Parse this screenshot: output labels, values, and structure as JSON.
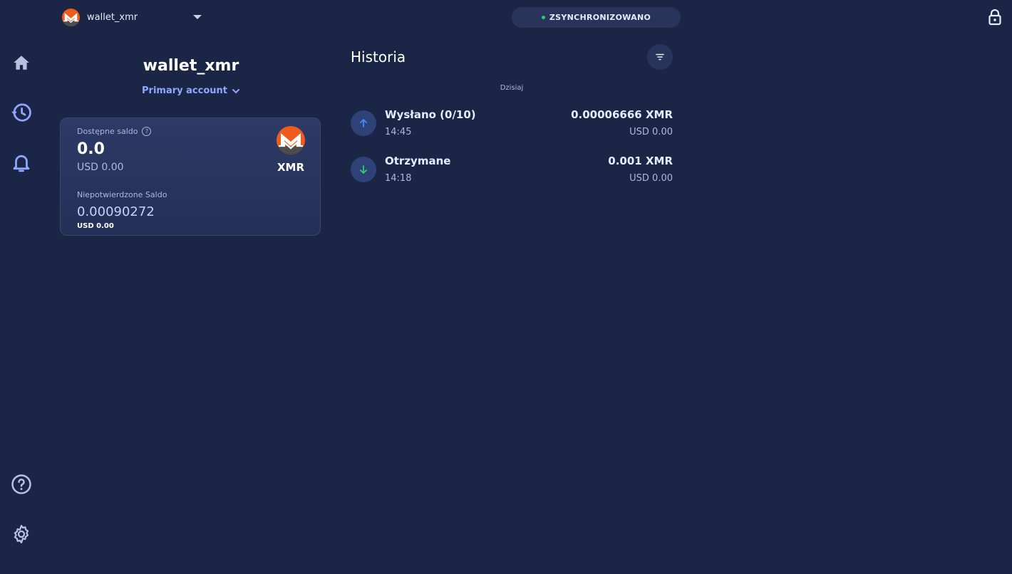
{
  "header": {
    "wallet_name": "wallet_xmr",
    "sync_status": "ZSYNCHRONIZOWANO"
  },
  "sidebar": {
    "items": [
      {
        "icon": "home-icon"
      },
      {
        "icon": "history-icon"
      },
      {
        "icon": "bell-icon"
      },
      {
        "icon": "help-icon"
      },
      {
        "icon": "gear-icon"
      }
    ]
  },
  "wallet": {
    "title": "wallet_xmr",
    "account": "Primary account"
  },
  "balance": {
    "available_label": "Dostępne saldo",
    "available_value": "0.0",
    "available_usd": "USD 0.00",
    "unconfirmed_label": "Niepotwierdzone Saldo",
    "unconfirmed_value": "0.00090272",
    "unconfirmed_usd": "USD 0.00",
    "ticker": "XMR"
  },
  "history": {
    "title": "Historia",
    "date_group": "Dzisiaj",
    "transactions": [
      {
        "type": "Wysłano (0/10)",
        "time": "14:45",
        "amount": "0.00006666 XMR",
        "usd": "USD 0.00",
        "direction": "sent"
      },
      {
        "type": "Otrzymane",
        "time": "14:18",
        "amount": "0.001 XMR",
        "usd": "USD 0.00",
        "direction": "received"
      }
    ]
  },
  "colors": {
    "background": "#1b2647",
    "accent": "#8fa8ff",
    "monero_orange": "#ef5b1d",
    "synced_green": "#2fcf6b",
    "sent_arrow": "#3f8cff",
    "received_arrow": "#2fcf6b"
  }
}
